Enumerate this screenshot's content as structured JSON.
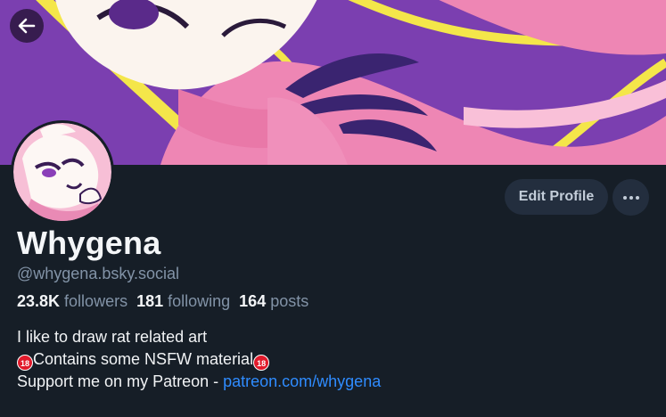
{
  "profile": {
    "display_name": "Whygena",
    "handle": "@whygena.bsky.social",
    "followers_count": "23.8K",
    "followers_label": "followers",
    "following_count": "181",
    "following_label": "following",
    "posts_count": "164",
    "posts_label": "posts"
  },
  "actions": {
    "edit_profile_label": "Edit Profile",
    "more_icon": "ellipsis-icon",
    "back_icon": "arrow-left-icon"
  },
  "bio": {
    "line1": "I like to draw rat related art",
    "line2_text": "Contains some NSFW material",
    "nsfw_badge": "18",
    "line3_prefix": "Support me on my Patreon - ",
    "link_text": "patreon.com/whygena"
  },
  "colors": {
    "background": "#161e27",
    "banner_purple": "#7b3fb0",
    "link": "#2f8cff",
    "muted": "#8293a7",
    "button": "#232e3e"
  }
}
